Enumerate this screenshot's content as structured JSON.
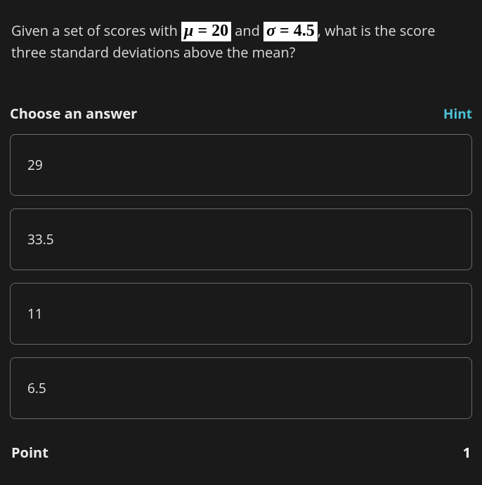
{
  "question": {
    "prefix": "Given a set of scores with ",
    "formula1": "μ = 20",
    "mid": " and ",
    "formula2": "σ = 4.5",
    "suffix": ", what is the score three standard deviations above the mean?"
  },
  "choose_label": "Choose an answer",
  "hint_label": "Hint",
  "options": [
    "29",
    "33.5",
    "11",
    "6.5"
  ],
  "point": {
    "label": "Point",
    "value": "1"
  }
}
